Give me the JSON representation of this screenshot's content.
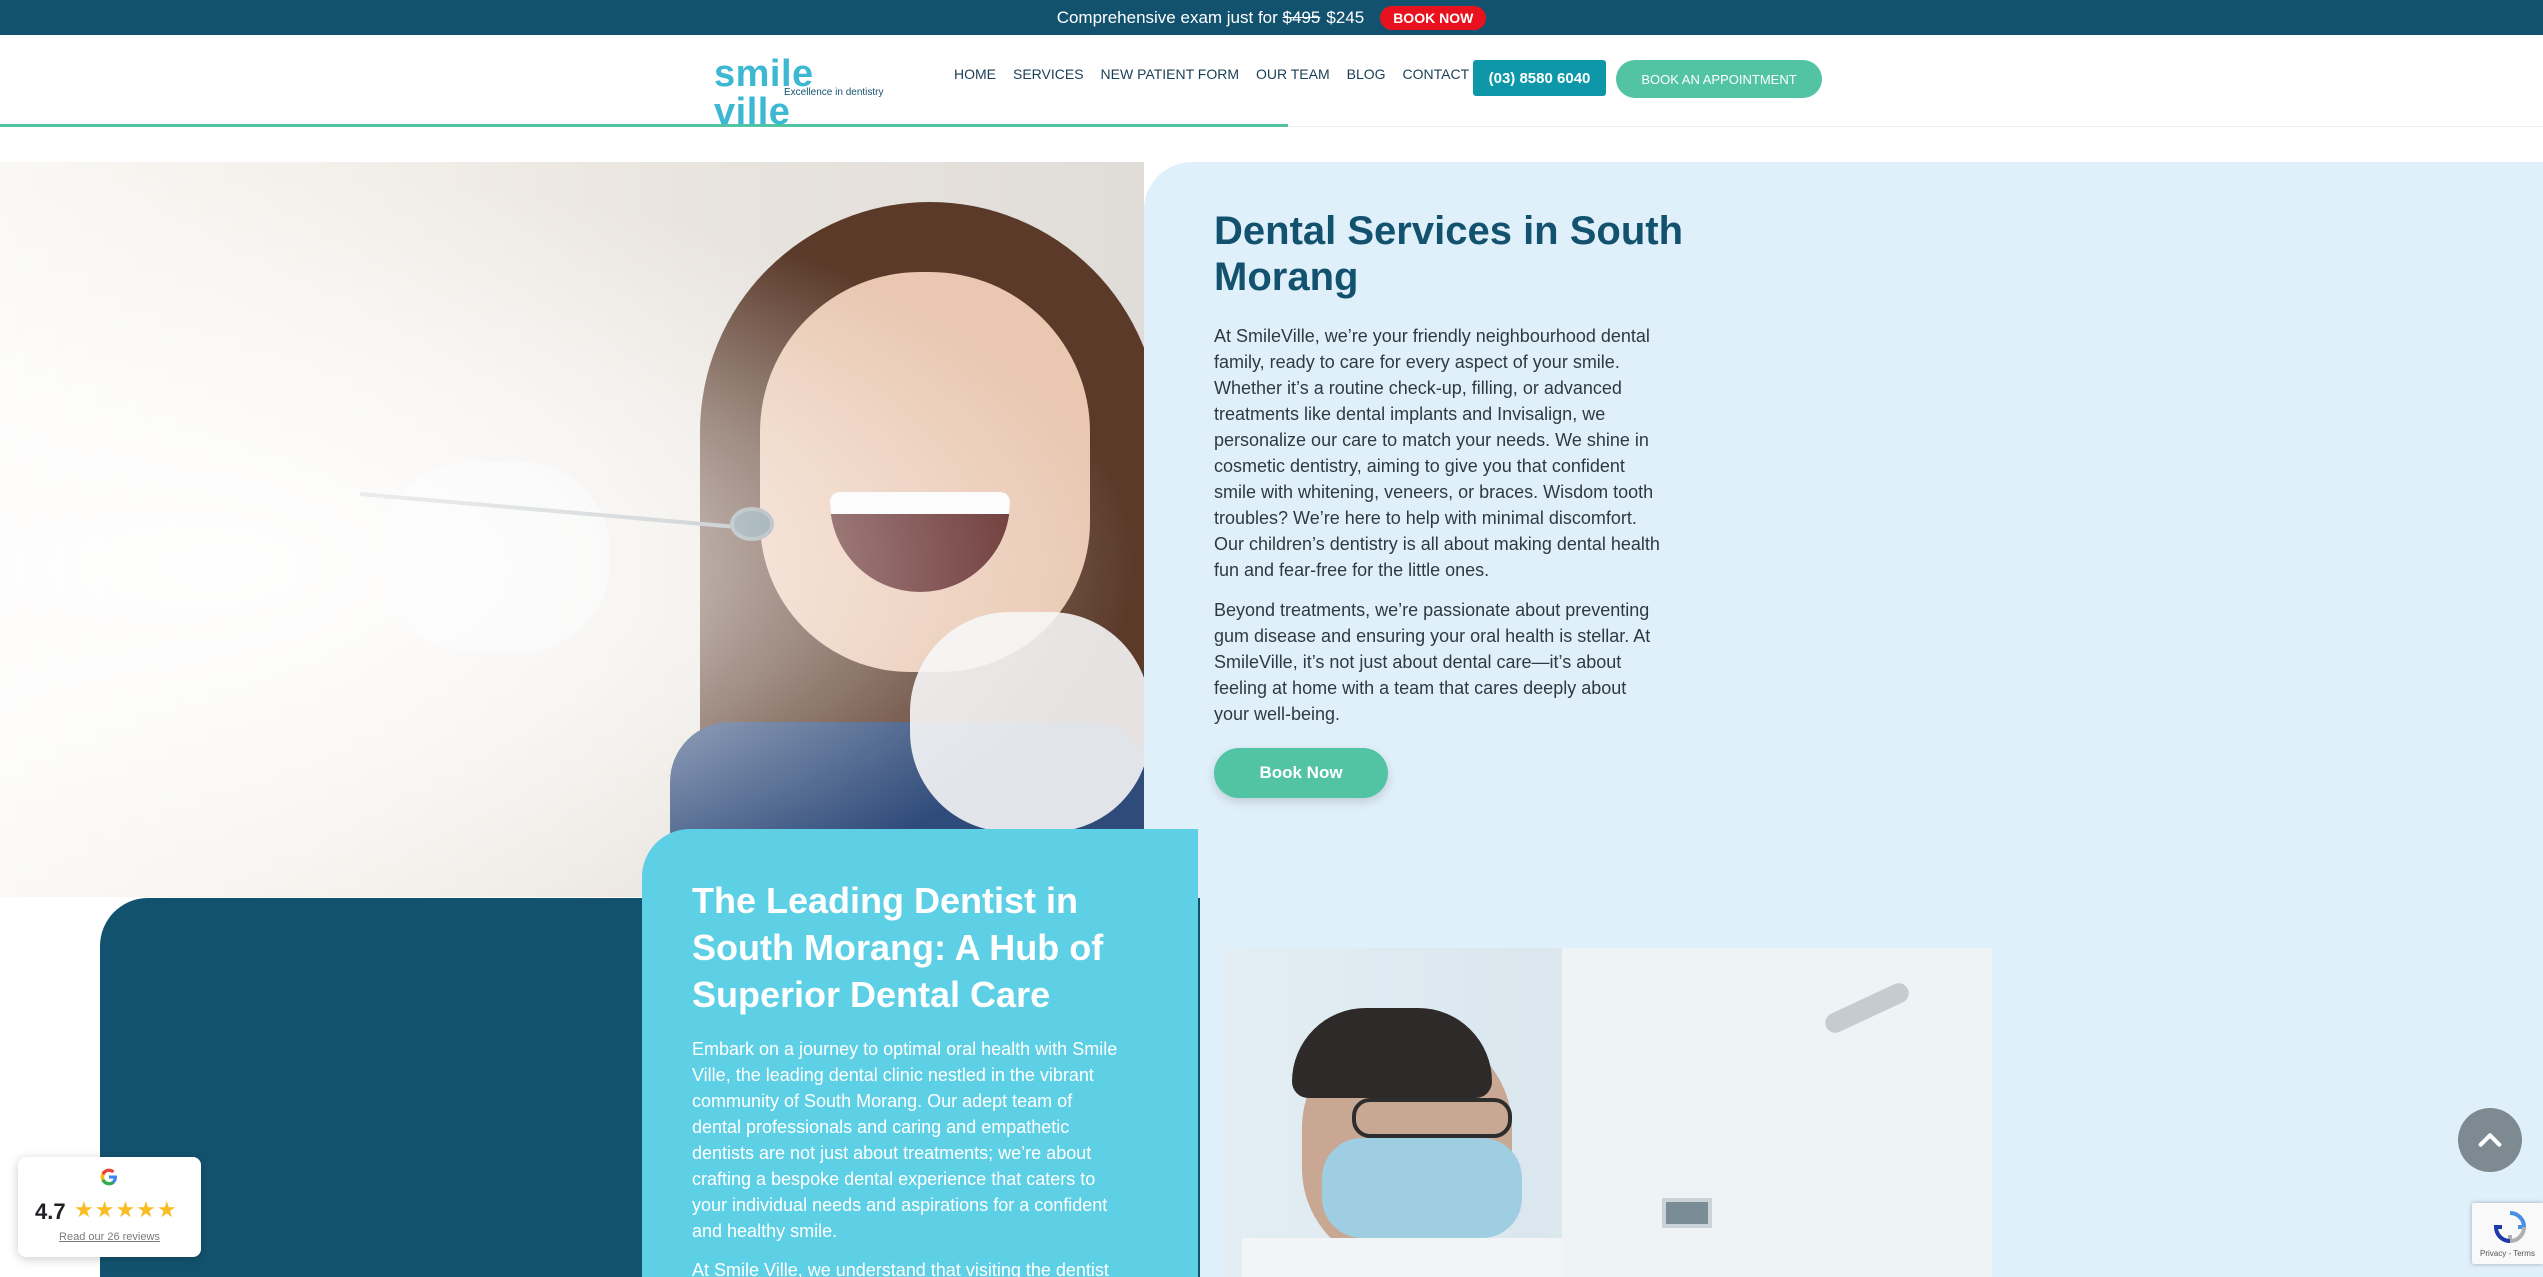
{
  "promo": {
    "text": "Comprehensive exam just for",
    "old_price": "$495",
    "new_price": "$245",
    "cta": "BOOK NOW"
  },
  "header": {
    "logo_word": "smile ville",
    "logo_tagline": "Excellence in dentistry",
    "nav": [
      "HOME",
      "SERVICES",
      "NEW PATIENT FORM",
      "OUR TEAM",
      "BLOG",
      "CONTACT US"
    ],
    "phone": "(03) 8580 6040",
    "appointment_cta": "BOOK AN APPOINTMENT"
  },
  "services": {
    "title": "Dental Services in South Morang",
    "paragraph1": "At SmileVille, we’re your friendly neighbourhood dental family, ready to care for every aspect of your smile. Whether it’s a routine check-up, filling, or advanced treatments like dental implants and Invisalign, we personalize our care to match your needs. We shine in cosmetic dentistry, aiming to give you that confident smile with whitening, veneers, or braces. Wisdom tooth troubles? We’re here to help with minimal discomfort. Our children’s dentistry is all about making dental health fun and fear-free for the little ones.",
    "paragraph2": "Beyond treatments, we’re passionate about preventing gum disease and ensuring your oral health is stellar. At SmileVille, it’s not just about dental care—it’s about feeling at home with a team that cares deeply about your well-being.",
    "cta": "Book Now"
  },
  "leading": {
    "title": "The Leading Dentist in South Morang: A Hub of Superior Dental Care",
    "paragraph1": "Embark on a journey to optimal oral health with Smile Ville, the leading dental clinic nestled in the vibrant community of South Morang. Our adept team of dental professionals and caring and empathetic dentists are not just about treatments; we’re about crafting a bespoke dental experience that caters to your individual needs and aspirations for a confident and healthy smile.",
    "paragraph2": "At Smile Ville, we understand that visiting the dentist"
  },
  "review_widget": {
    "rating": "4.7",
    "stars": "★★★★★",
    "link": "Read our 26 reviews"
  },
  "recaptcha": {
    "label": "Privacy - Terms"
  },
  "colors": {
    "navy": "#13526f",
    "teal": "#52c3a3",
    "cyan": "#5ed0e5",
    "light_blue": "#e0f0fb",
    "promo_red": "#e8121f"
  },
  "icons": [
    "google-icon",
    "chevron-up-icon",
    "recaptcha-icon"
  ]
}
